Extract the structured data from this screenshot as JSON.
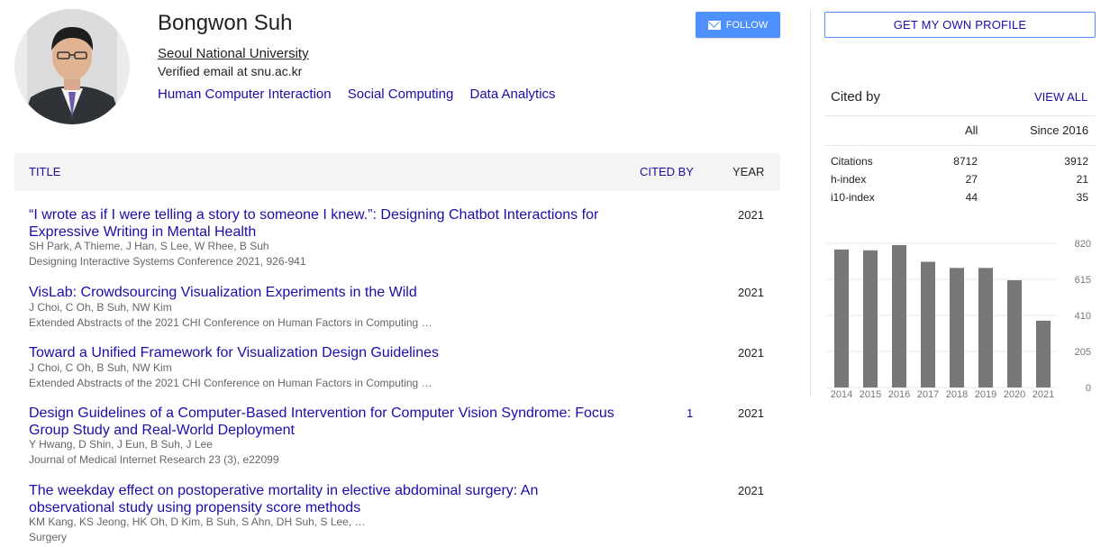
{
  "profile": {
    "name": "Bongwon Suh",
    "affiliation": "Seoul National University",
    "email": "Verified email at snu.ac.kr",
    "interests": [
      "Human Computer Interaction",
      "Social Computing",
      "Data Analytics"
    ],
    "follow_label": "FOLLOW"
  },
  "table": {
    "headers": {
      "title": "TITLE",
      "cited_by": "CITED BY",
      "year": "YEAR"
    },
    "articles": [
      {
        "title": "“I wrote as if I were telling a story to someone I knew.”: Designing Chatbot Interactions for Expressive Writing in Mental Health",
        "authors": "SH Park, A Thieme, J Han, S Lee, W Rhee, B Suh",
        "venue": "Designing Interactive Systems Conference 2021, 926-941",
        "cited_by": "",
        "year": "2021"
      },
      {
        "title": "VisLab: Crowdsourcing Visualization Experiments in the Wild",
        "authors": "J Choi, C Oh, B Suh, NW Kim",
        "venue": "Extended Abstracts of the 2021 CHI Conference on Human Factors in Computing …",
        "cited_by": "",
        "year": "2021"
      },
      {
        "title": "Toward a Unified Framework for Visualization Design Guidelines",
        "authors": "J Choi, C Oh, B Suh, NW Kim",
        "venue": "Extended Abstracts of the 2021 CHI Conference on Human Factors in Computing …",
        "cited_by": "",
        "year": "2021"
      },
      {
        "title": "Design Guidelines of a Computer-Based Intervention for Computer Vision Syndrome: Focus Group Study and Real-World Deployment",
        "authors": "Y Hwang, D Shin, J Eun, B Suh, J Lee",
        "venue": "Journal of Medical Internet Research 23 (3), e22099",
        "cited_by": "1",
        "year": "2021"
      },
      {
        "title": "The weekday effect on postoperative mortality in elective abdominal surgery: An observational study using propensity score methods",
        "authors": "KM Kang, KS Jeong, HK Oh, D Kim, B Suh, S Ahn, DH Suh, S Lee, …",
        "venue": "Surgery",
        "cited_by": "",
        "year": "2021"
      }
    ]
  },
  "sidebar": {
    "profile_button": "GET MY OWN PROFILE",
    "cited_by_title": "Cited by",
    "view_all": "VIEW ALL",
    "col_all": "All",
    "col_since": "Since 2016",
    "stats": [
      {
        "label": "Citations",
        "all": "8712",
        "since": "3912"
      },
      {
        "label": "h-index",
        "all": "27",
        "since": "21"
      },
      {
        "label": "i10-index",
        "all": "44",
        "since": "35"
      }
    ]
  },
  "colors": {
    "link": "#1a0dab",
    "button": "#4d90fe",
    "bar": "#777777"
  },
  "chart_data": {
    "type": "bar",
    "categories": [
      "2014",
      "2015",
      "2016",
      "2017",
      "2018",
      "2019",
      "2020",
      "2021"
    ],
    "values": [
      785,
      780,
      810,
      715,
      680,
      680,
      610,
      380
    ],
    "yticks": [
      "820",
      "615",
      "410",
      "205",
      "0"
    ],
    "ylim": [
      0,
      820
    ],
    "grid": true
  }
}
